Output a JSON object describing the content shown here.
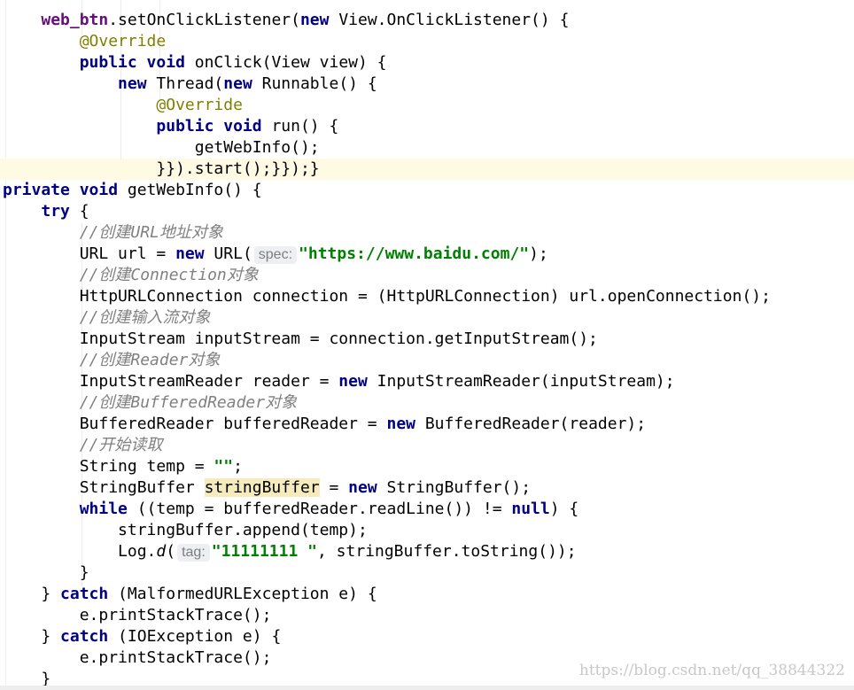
{
  "code": {
    "lines": [
      [
        "    ",
        {
          "f": "web_btn"
        },
        ".setOnClickListener(",
        {
          "k": "new"
        },
        " View.OnClickListener() {"
      ],
      [
        "        ",
        {
          "a": "@Override"
        }
      ],
      [
        "        ",
        {
          "k": "public void"
        },
        " onClick(View view) {"
      ],
      [
        "            ",
        {
          "k": "new"
        },
        " Thread(",
        {
          "k": "new"
        },
        " Runnable() {"
      ],
      [
        "                ",
        {
          "a": "@Override"
        }
      ],
      [
        "                ",
        {
          "k": "public void"
        },
        " run() {"
      ],
      [
        "                    getWebInfo();"
      ],
      [
        "                }}).start();}});}"
      ],
      [
        {
          "k": "private void"
        },
        " getWebInfo() {"
      ],
      [
        "    ",
        {
          "k": "try"
        },
        " {"
      ],
      [
        "        ",
        {
          "c": "//创建URL地址对象"
        }
      ],
      [
        "        URL url = ",
        {
          "k": "new"
        },
        " URL(",
        {
          "h": "spec:"
        },
        {
          "s": "\"https://www.baidu.com/\""
        },
        ");"
      ],
      [
        "        ",
        {
          "c": "//创建Connection对象"
        }
      ],
      [
        "        HttpURLConnection connection = (HttpURLConnection) url.openConnection();"
      ],
      [
        "        ",
        {
          "c": "//创建输入流对象"
        }
      ],
      [
        "        InputStream inputStream = connection.getInputStream();"
      ],
      [
        "        ",
        {
          "c": "//创建Reader对象"
        }
      ],
      [
        "        InputStreamReader reader = ",
        {
          "k": "new"
        },
        " InputStreamReader(inputStream);"
      ],
      [
        "        ",
        {
          "c": "//创建BufferedReader对象"
        }
      ],
      [
        "        BufferedReader bufferedReader = ",
        {
          "k": "new"
        },
        " BufferedReader(reader);"
      ],
      [
        "        ",
        {
          "c": "//开始读取"
        }
      ],
      [
        "        String temp = ",
        {
          "s": "\"\""
        },
        ";"
      ],
      [
        "        StringBuffer ",
        {
          "m": "stringBuffer"
        },
        " = ",
        {
          "k": "new"
        },
        " StringBuffer();"
      ],
      [
        "        ",
        {
          "k": "while"
        },
        " ((temp = bufferedReader.readLine()) != ",
        {
          "k": "null"
        },
        ") {"
      ],
      [
        "            stringBuffer.append(temp);"
      ],
      [
        "            Log.",
        {
          "i": "d"
        },
        "(",
        {
          "h": "tag:"
        },
        {
          "s": "\"11111111 \""
        },
        ", stringBuffer.toString());"
      ],
      [
        "        }"
      ],
      [
        "    } ",
        {
          "k": "catch"
        },
        " (MalformedURLException e) {"
      ],
      [
        "        e.printStackTrace();"
      ],
      [
        "    } ",
        {
          "k": "catch"
        },
        " (IOException e) {"
      ],
      [
        "        e.printStackTrace();"
      ],
      [
        "    }"
      ]
    ]
  },
  "watermark": "https://blog.csdn.net/qq_38844322",
  "colors": {
    "keyword": "#000080",
    "field": "#660e7a",
    "annotation": "#808000",
    "string": "#008000",
    "comment": "#808080",
    "current_line": "#fffae3",
    "usage_highlight": "#f6ebbc"
  }
}
